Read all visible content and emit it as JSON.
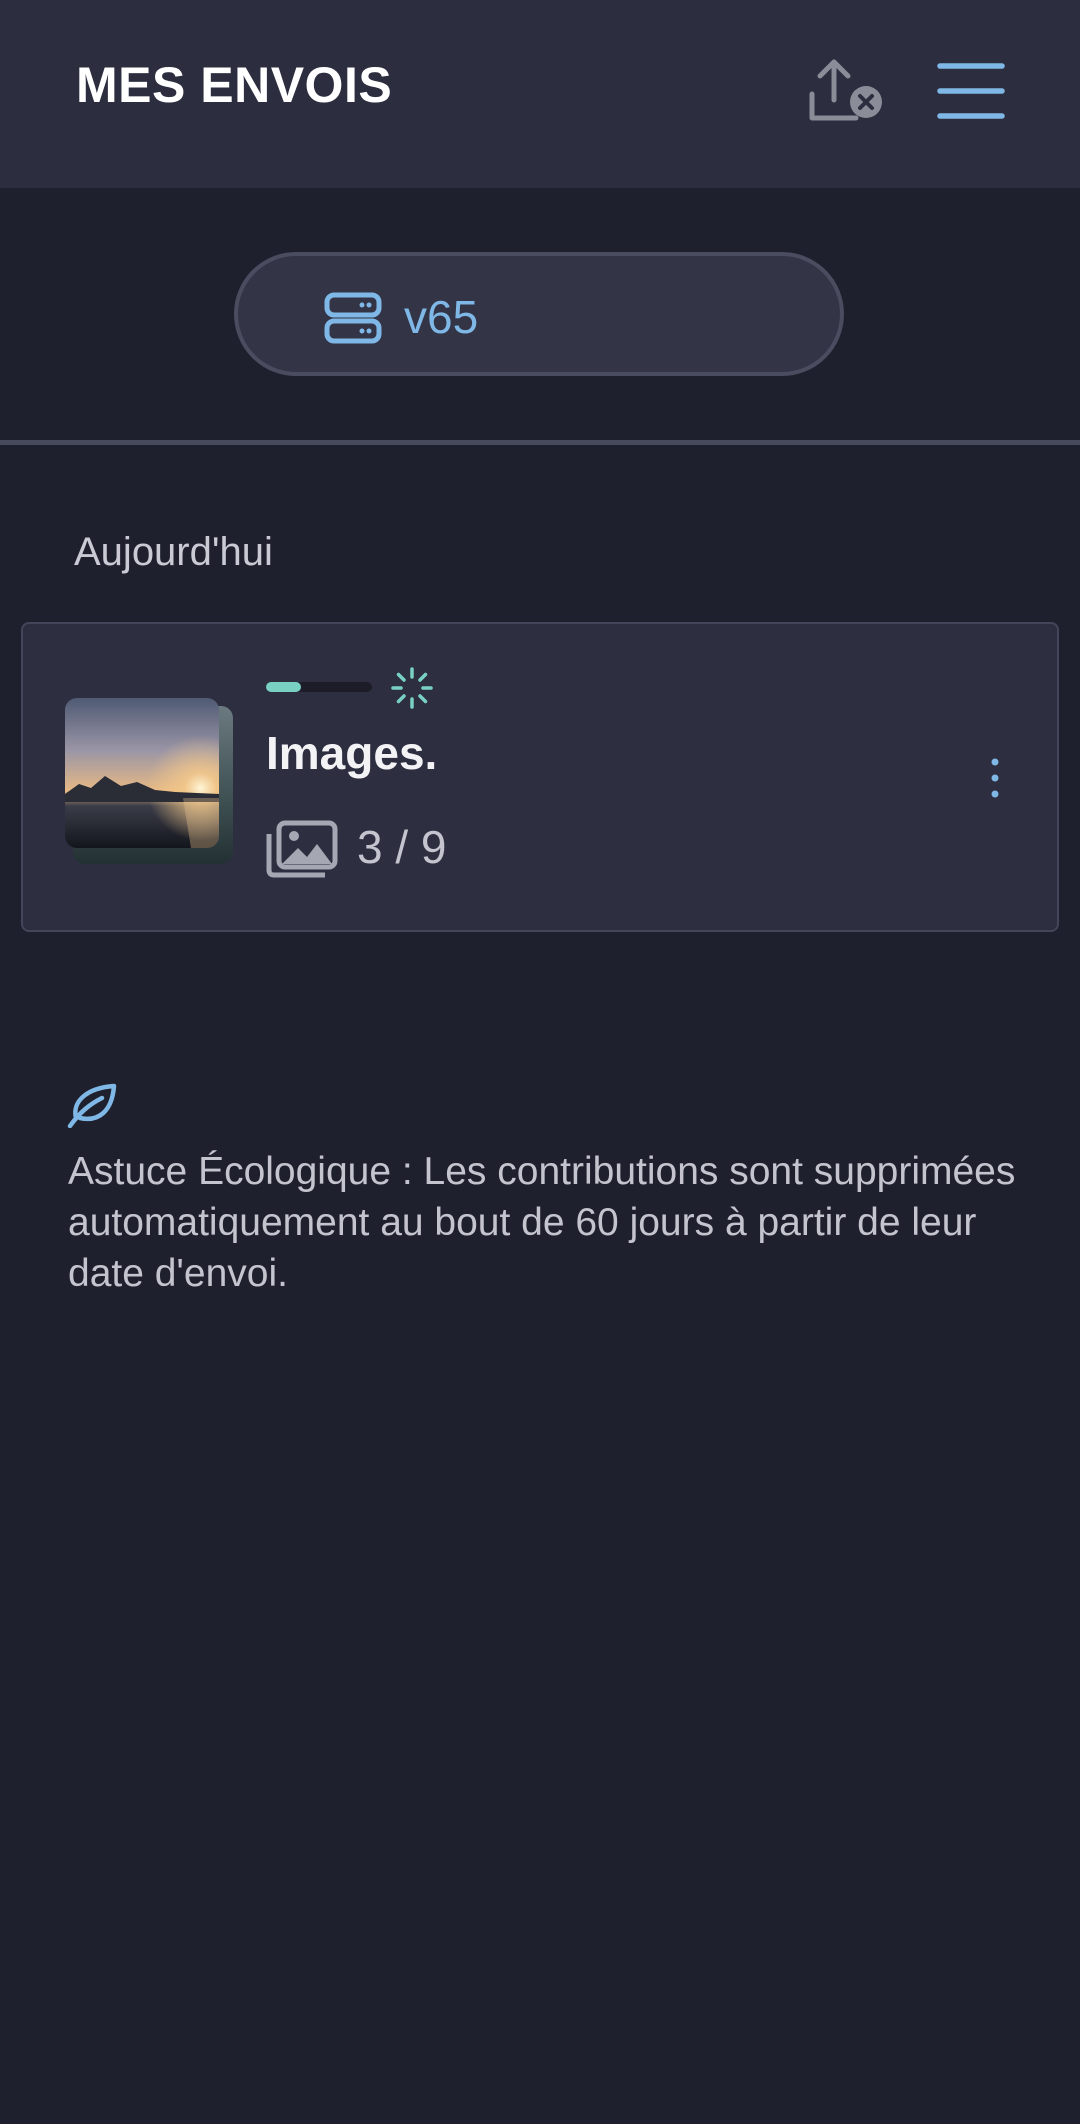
{
  "header": {
    "title": "MES ENVOIS",
    "upload_cancel_icon": "upload-cancel-icon",
    "menu_icon": "hamburger-menu-icon"
  },
  "server": {
    "label": "v65",
    "icon": "server-icon"
  },
  "section": {
    "label": "Aujourd'hui"
  },
  "upload_item": {
    "title": "Images.",
    "count": "3 / 9",
    "progress": 0.33,
    "status_icon": "loading-spinner-icon",
    "type_icon": "images-icon",
    "more_icon": "more-vertical-icon"
  },
  "tip": {
    "icon": "leaf-icon",
    "text": "Astuce Écologique : Les contributions sont supprimées automatiquement au bout de 60 jours à partir de leur date d'envoi."
  },
  "colors": {
    "background": "#1f202d",
    "topbar": "#2c2e3f",
    "card": "#2d2f41",
    "accent_blue": "#7fb8e6",
    "progress": "#79d1c3"
  }
}
